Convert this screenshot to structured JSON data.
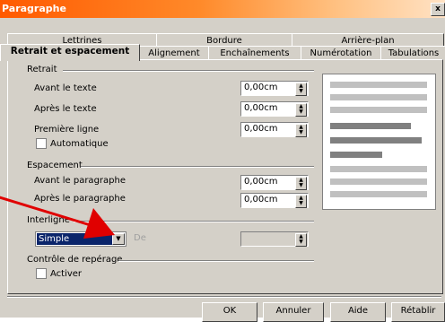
{
  "window": {
    "title": "Paragraphe",
    "close_label": "x"
  },
  "tabs_back": [
    "Lettrines",
    "Bordure",
    "Arrière-plan"
  ],
  "tabs_front": [
    "Retrait et espacement",
    "Alignement",
    "Enchaînements",
    "Numérotation",
    "Tabulations"
  ],
  "retrait": {
    "section": "Retrait",
    "avant_label": "Avant le texte",
    "avant_value": "0,00cm",
    "apres_label": "Après le texte",
    "apres_value": "0,00cm",
    "premiere_label": "Première ligne",
    "premiere_value": "0,00cm",
    "auto_label": "Automatique"
  },
  "espacement": {
    "section": "Espacement",
    "avant_label": "Avant le paragraphe",
    "avant_value": "0,00cm",
    "apres_label": "Après le paragraphe",
    "apres_value": "0,00cm"
  },
  "interligne": {
    "section": "Interligne",
    "selected": "Simple",
    "de_label": "De",
    "de_value": ""
  },
  "controle": {
    "section": "Contrôle de repérage",
    "activer_label": "Activer"
  },
  "buttons": {
    "ok": "OK",
    "annuler": "Annuler",
    "aide": "Aide",
    "retablir": "Rétablir"
  },
  "colors": {
    "titlebar": "#ff5a00",
    "arrow": "#e00000",
    "selection": "#0a246a"
  }
}
